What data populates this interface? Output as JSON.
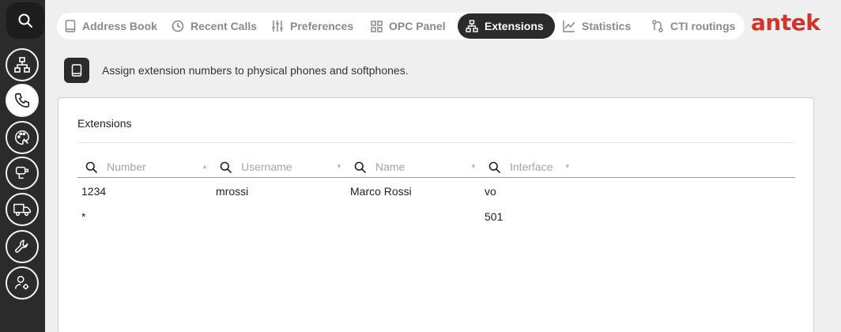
{
  "rail": {
    "items": [
      {
        "name": "search",
        "icon": "search-icon"
      },
      {
        "name": "network",
        "icon": "network-icon"
      },
      {
        "name": "phone",
        "icon": "phone-icon",
        "active": true
      },
      {
        "name": "palette",
        "icon": "palette-icon"
      },
      {
        "name": "telephone-desk",
        "icon": "desk-phone-icon"
      },
      {
        "name": "truck",
        "icon": "truck-icon"
      },
      {
        "name": "wrench",
        "icon": "wrench-icon"
      },
      {
        "name": "user-settings",
        "icon": "user-gear-icon"
      }
    ]
  },
  "tabs": [
    {
      "label": "Address Book",
      "icon": "book-icon"
    },
    {
      "label": "Recent Calls",
      "icon": "clock-icon"
    },
    {
      "label": "Preferences",
      "icon": "sliders-icon"
    },
    {
      "label": "OPC Panel",
      "icon": "grid-icon"
    },
    {
      "label": "Extensions",
      "icon": "network-icon",
      "active": true
    },
    {
      "label": "Statistics",
      "icon": "chart-icon"
    },
    {
      "label": "CTI routings",
      "icon": "routing-icon"
    }
  ],
  "logo": "antek",
  "description": "Assign extension numbers to physical phones and softphones.",
  "panel": {
    "title": "Extensions",
    "columns": [
      {
        "placeholder": "Number",
        "sort": "▲"
      },
      {
        "placeholder": "Username",
        "sort": "▼"
      },
      {
        "placeholder": "Name",
        "sort": "▼"
      },
      {
        "placeholder": "Interface",
        "sort": "▼"
      }
    ],
    "rows": [
      [
        "1234",
        "mrossi",
        "Marco Rossi",
        "vo"
      ],
      [
        "*",
        "",
        "",
        "501"
      ]
    ]
  },
  "colors": {
    "rail": "#2b2b2b",
    "active_tab": "#2b2b2b",
    "logo": "#d6322a",
    "background": "#efefef"
  }
}
